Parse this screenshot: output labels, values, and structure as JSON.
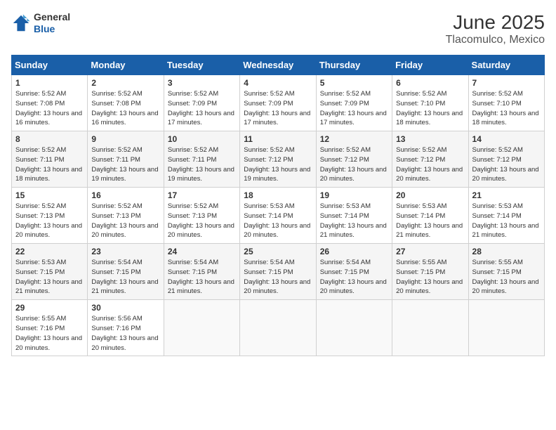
{
  "header": {
    "logo_general": "General",
    "logo_blue": "Blue",
    "title": "June 2025",
    "subtitle": "Tlacomulco, Mexico"
  },
  "calendar": {
    "days_of_week": [
      "Sunday",
      "Monday",
      "Tuesday",
      "Wednesday",
      "Thursday",
      "Friday",
      "Saturday"
    ],
    "weeks": [
      [
        null,
        null,
        null,
        null,
        null,
        null,
        null
      ]
    ],
    "cells": [
      [
        null,
        null,
        null,
        null,
        null,
        null,
        null
      ]
    ],
    "rows": [
      {
        "days": [
          {
            "num": "1",
            "sunrise": "5:52 AM",
            "sunset": "7:08 PM",
            "daylight": "13 hours and 16 minutes."
          },
          {
            "num": "2",
            "sunrise": "5:52 AM",
            "sunset": "7:08 PM",
            "daylight": "13 hours and 16 minutes."
          },
          {
            "num": "3",
            "sunrise": "5:52 AM",
            "sunset": "7:09 PM",
            "daylight": "13 hours and 17 minutes."
          },
          {
            "num": "4",
            "sunrise": "5:52 AM",
            "sunset": "7:09 PM",
            "daylight": "13 hours and 17 minutes."
          },
          {
            "num": "5",
            "sunrise": "5:52 AM",
            "sunset": "7:09 PM",
            "daylight": "13 hours and 17 minutes."
          },
          {
            "num": "6",
            "sunrise": "5:52 AM",
            "sunset": "7:10 PM",
            "daylight": "13 hours and 18 minutes."
          },
          {
            "num": "7",
            "sunrise": "5:52 AM",
            "sunset": "7:10 PM",
            "daylight": "13 hours and 18 minutes."
          }
        ]
      },
      {
        "days": [
          {
            "num": "8",
            "sunrise": "5:52 AM",
            "sunset": "7:11 PM",
            "daylight": "13 hours and 18 minutes."
          },
          {
            "num": "9",
            "sunrise": "5:52 AM",
            "sunset": "7:11 PM",
            "daylight": "13 hours and 19 minutes."
          },
          {
            "num": "10",
            "sunrise": "5:52 AM",
            "sunset": "7:11 PM",
            "daylight": "13 hours and 19 minutes."
          },
          {
            "num": "11",
            "sunrise": "5:52 AM",
            "sunset": "7:12 PM",
            "daylight": "13 hours and 19 minutes."
          },
          {
            "num": "12",
            "sunrise": "5:52 AM",
            "sunset": "7:12 PM",
            "daylight": "13 hours and 20 minutes."
          },
          {
            "num": "13",
            "sunrise": "5:52 AM",
            "sunset": "7:12 PM",
            "daylight": "13 hours and 20 minutes."
          },
          {
            "num": "14",
            "sunrise": "5:52 AM",
            "sunset": "7:12 PM",
            "daylight": "13 hours and 20 minutes."
          }
        ]
      },
      {
        "days": [
          {
            "num": "15",
            "sunrise": "5:52 AM",
            "sunset": "7:13 PM",
            "daylight": "13 hours and 20 minutes."
          },
          {
            "num": "16",
            "sunrise": "5:52 AM",
            "sunset": "7:13 PM",
            "daylight": "13 hours and 20 minutes."
          },
          {
            "num": "17",
            "sunrise": "5:52 AM",
            "sunset": "7:13 PM",
            "daylight": "13 hours and 20 minutes."
          },
          {
            "num": "18",
            "sunrise": "5:53 AM",
            "sunset": "7:14 PM",
            "daylight": "13 hours and 20 minutes."
          },
          {
            "num": "19",
            "sunrise": "5:53 AM",
            "sunset": "7:14 PM",
            "daylight": "13 hours and 21 minutes."
          },
          {
            "num": "20",
            "sunrise": "5:53 AM",
            "sunset": "7:14 PM",
            "daylight": "13 hours and 21 minutes."
          },
          {
            "num": "21",
            "sunrise": "5:53 AM",
            "sunset": "7:14 PM",
            "daylight": "13 hours and 21 minutes."
          }
        ]
      },
      {
        "days": [
          {
            "num": "22",
            "sunrise": "5:53 AM",
            "sunset": "7:15 PM",
            "daylight": "13 hours and 21 minutes."
          },
          {
            "num": "23",
            "sunrise": "5:54 AM",
            "sunset": "7:15 PM",
            "daylight": "13 hours and 21 minutes."
          },
          {
            "num": "24",
            "sunrise": "5:54 AM",
            "sunset": "7:15 PM",
            "daylight": "13 hours and 21 minutes."
          },
          {
            "num": "25",
            "sunrise": "5:54 AM",
            "sunset": "7:15 PM",
            "daylight": "13 hours and 20 minutes."
          },
          {
            "num": "26",
            "sunrise": "5:54 AM",
            "sunset": "7:15 PM",
            "daylight": "13 hours and 20 minutes."
          },
          {
            "num": "27",
            "sunrise": "5:55 AM",
            "sunset": "7:15 PM",
            "daylight": "13 hours and 20 minutes."
          },
          {
            "num": "28",
            "sunrise": "5:55 AM",
            "sunset": "7:15 PM",
            "daylight": "13 hours and 20 minutes."
          }
        ]
      },
      {
        "days": [
          {
            "num": "29",
            "sunrise": "5:55 AM",
            "sunset": "7:16 PM",
            "daylight": "13 hours and 20 minutes."
          },
          {
            "num": "30",
            "sunrise": "5:56 AM",
            "sunset": "7:16 PM",
            "daylight": "13 hours and 20 minutes."
          },
          null,
          null,
          null,
          null,
          null
        ]
      }
    ]
  }
}
